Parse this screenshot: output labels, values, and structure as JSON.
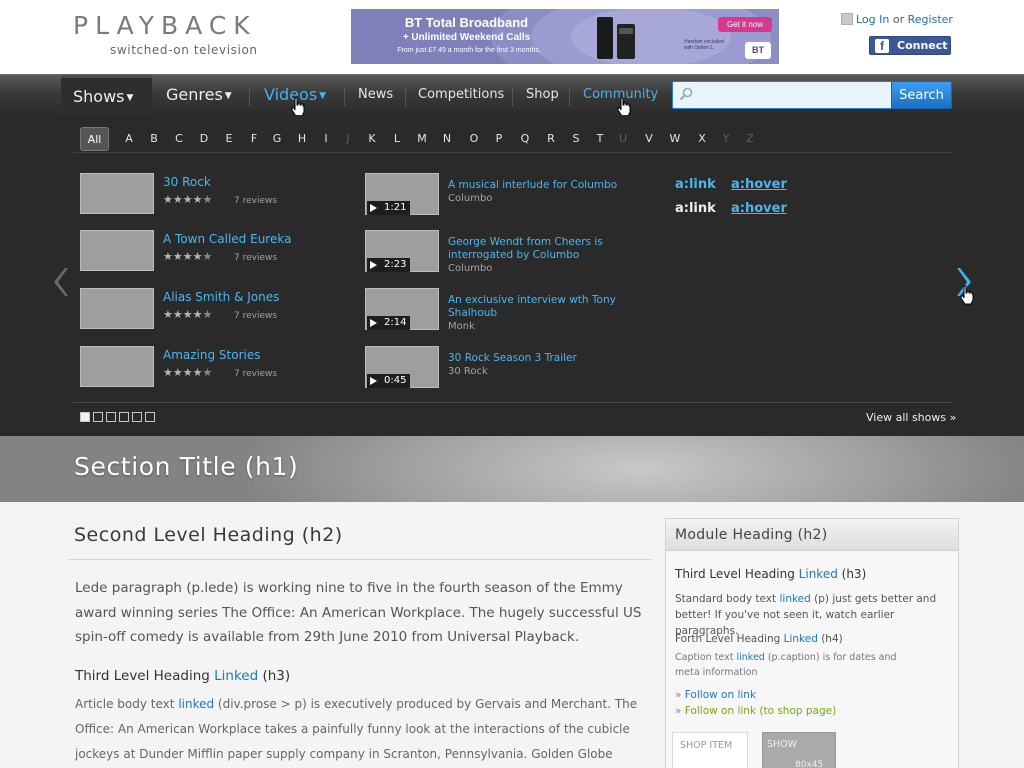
{
  "brand": {
    "name": "PLAYBACK",
    "tagline": "switched-on television"
  },
  "ad": {
    "title": "BT Total Broadband",
    "subtitle": "+ Unlimited Weekend Calls",
    "fineprint": "From just £7.49 a month for the first 3 months.",
    "cta": "Get it now",
    "smallprint": "Handset excluded with Option 1.",
    "logo": "BT"
  },
  "auth": {
    "login": "Log In",
    "or": "or",
    "register": "Register",
    "facebook": "Connect"
  },
  "nav": {
    "shows": "Shows",
    "genres": "Genres",
    "videos": "Videos",
    "news": "News",
    "competitions": "Competitions",
    "shop": "Shop",
    "community": "Community"
  },
  "search": {
    "value": "",
    "button": "Search"
  },
  "alphabet": {
    "all": "All",
    "letters": [
      "A",
      "B",
      "C",
      "D",
      "E",
      "F",
      "G",
      "H",
      "I",
      "J",
      "K",
      "L",
      "M",
      "N",
      "O",
      "P",
      "Q",
      "R",
      "S",
      "T",
      "U",
      "V",
      "W",
      "X",
      "Y",
      "Z"
    ],
    "disabled": [
      "J",
      "U",
      "Y",
      "Z"
    ]
  },
  "shows": [
    {
      "title": "30 Rock",
      "rating": 4,
      "reviews": "7 reviews"
    },
    {
      "title": "A Town Called Eureka",
      "rating": 4,
      "reviews": "7 reviews"
    },
    {
      "title": "Alias Smith & Jones",
      "rating": 4,
      "reviews": "7 reviews"
    },
    {
      "title": "Amazing Stories",
      "rating": 4,
      "reviews": "7 reviews"
    }
  ],
  "videos": [
    {
      "title": "A musical interlude for Columbo",
      "show": "Columbo",
      "duration": "1:21"
    },
    {
      "title": "George Wendt from Cheers is interrogated by Columbo",
      "show": "Columbo",
      "duration": "2:23"
    },
    {
      "title": "An exclusive interview wth Tony Shalhoub",
      "show": "Monk",
      "duration": "2:14"
    },
    {
      "title": "30 Rock Season 3 Trailer",
      "show": "30 Rock",
      "duration": "0:45"
    }
  ],
  "link_demo": {
    "link": "a:link",
    "hover": "a:hover"
  },
  "pager": {
    "count": 6,
    "active": 1,
    "view_all": "View all shows »"
  },
  "section": {
    "title": "Section Title (h1)"
  },
  "content": {
    "h2": "Second Level Heading (h2)",
    "lede": "Lede paragraph (p.lede) is working nine to five in the fourth season of the Emmy award winning series The Office: An American Workplace. The hugely successful US spin-off comedy  is available from 29th June 2010 from Universal Playback.",
    "h3": "Third Level Heading ",
    "h3_link": "Linked",
    "h3_suffix": " (h3)",
    "prose_a": "Article body text ",
    "prose_link": "linked",
    "prose_b": " (div.prose > p) is executively produced by Gervais and Merchant. The Office: An American Workplace takes a painfully funny look at the interactions of the cubicle jockeys at Dunder Mifflin paper supply company in Scranton, Pennsylvania. Golden Globe winner"
  },
  "module": {
    "heading": "Module Heading (h2)",
    "h3": "Third Level Heading ",
    "h3_link": "Linked",
    "h3_suffix": " (h3)",
    "p_a": "Standard body text ",
    "p_link": "linked",
    "p_b": " (p) just gets better and better! If you've not seen it, watch earlier paragraphs.",
    "h4": "Forth Level Heading ",
    "h4_link": "Linked",
    "h4_suffix": " (h4)",
    "cap_a": "Caption text ",
    "cap_link": "linked",
    "cap_b": " (p.caption) is for dates and meta information",
    "follow1": "Follow on link",
    "follow2": "Follow on link (to shop page)",
    "shop_item": "SHOP ITEM",
    "show_label": "SHOW",
    "show_dim": "80x45"
  },
  "colors": {
    "accent": "#4bb6ef",
    "link": "#1d78c1",
    "green_link": "#77a80e",
    "panel": "#2a2a2a"
  },
  "icons": [
    "user-icon",
    "facebook-icon",
    "search-icon",
    "play-icon",
    "star-icon",
    "chevron-left-icon",
    "chevron-right-icon",
    "pointer-cursor-icon"
  ]
}
